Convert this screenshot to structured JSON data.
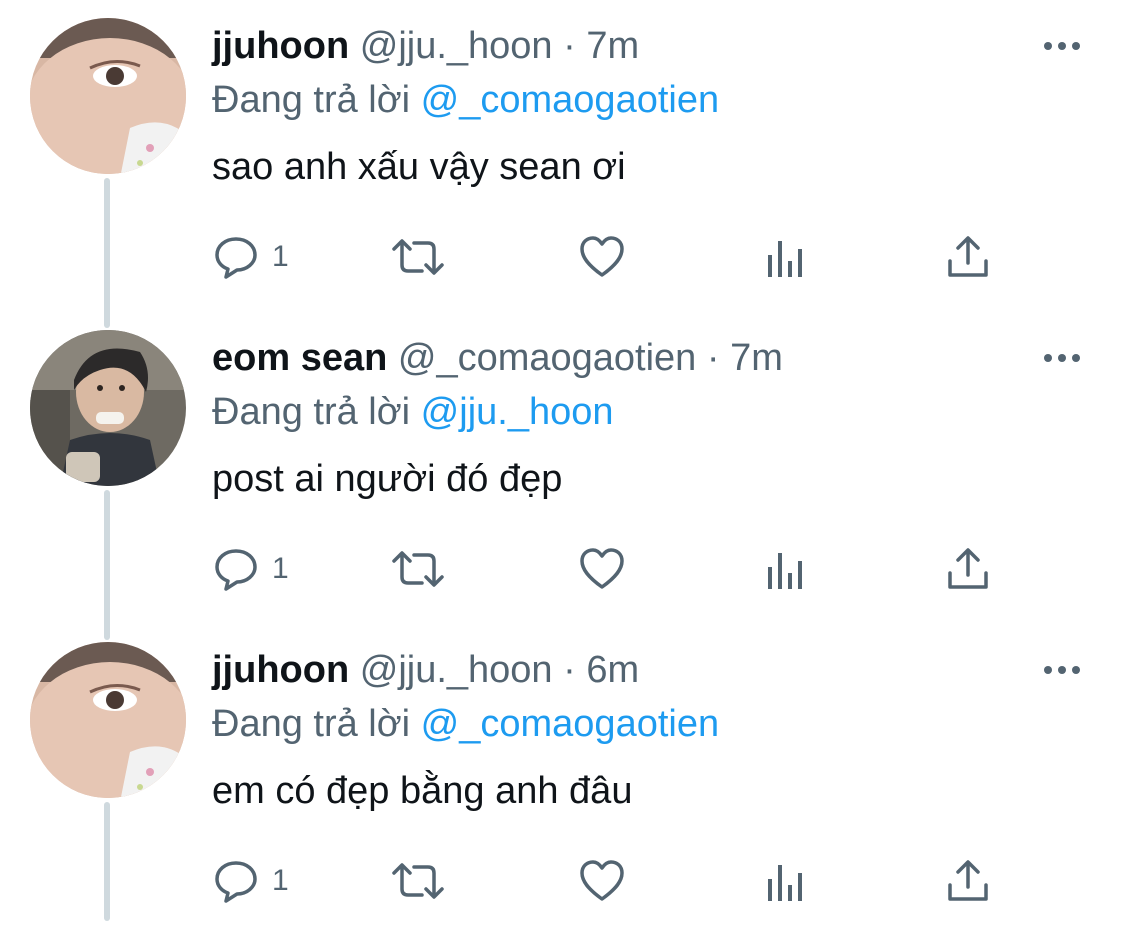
{
  "colors": {
    "text": "#0f1419",
    "secondary": "#536471",
    "accent": "#1d9bf0",
    "thread_line": "#cfd9de"
  },
  "tweets": [
    {
      "name": "jjuhoon",
      "handle": "@jju._hoon",
      "separator": "·",
      "time": "7m",
      "reply_prefix": "Đang trả lời",
      "reply_to": "@_comaogaotien",
      "text": "sao anh xấu vậy sean ơi",
      "reply_count": "1",
      "avatar": "jjuhoon-avatar"
    },
    {
      "name": "eom sean",
      "handle": "@_comaogaotien",
      "separator": "·",
      "time": "7m",
      "reply_prefix": "Đang trả lời",
      "reply_to": "@jju._hoon",
      "text": "post ai người đó đẹp",
      "reply_count": "1",
      "avatar": "eom-sean-avatar"
    },
    {
      "name": "jjuhoon",
      "handle": "@jju._hoon",
      "separator": "·",
      "time": "6m",
      "reply_prefix": "Đang trả lời",
      "reply_to": "@_comaogaotien",
      "text": "em có đẹp bằng anh đâu",
      "reply_count": "1",
      "avatar": "jjuhoon-avatar"
    }
  ],
  "icons": {
    "reply": "reply-icon",
    "retweet": "retweet-icon",
    "like": "heart-icon",
    "views": "views-icon",
    "share": "share-icon",
    "more": "more-icon"
  }
}
